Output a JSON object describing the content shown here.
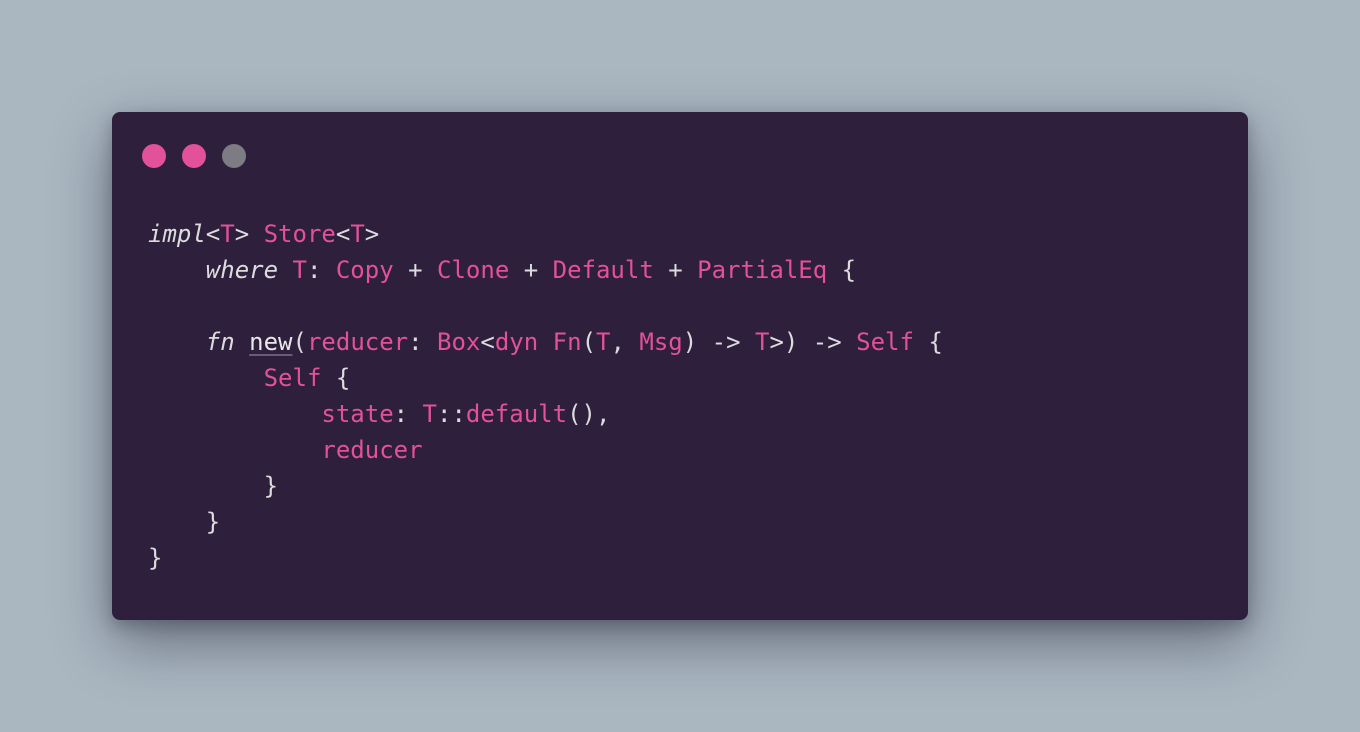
{
  "window": {
    "controls": [
      {
        "name": "close",
        "color": "#e2519a"
      },
      {
        "name": "minimize",
        "color": "#e2519a"
      },
      {
        "name": "zoom",
        "color": "#7c7c82"
      }
    ]
  },
  "code": {
    "lines": [
      [
        {
          "t": "impl",
          "c": "kw"
        },
        {
          "t": "<",
          "c": "pu"
        },
        {
          "t": "T",
          "c": "ty"
        },
        {
          "t": "> ",
          "c": "pu"
        },
        {
          "t": "Store",
          "c": "ty"
        },
        {
          "t": "<",
          "c": "pu"
        },
        {
          "t": "T",
          "c": "ty"
        },
        {
          "t": ">",
          "c": "pu"
        }
      ],
      [
        {
          "t": "    ",
          "c": "pl"
        },
        {
          "t": "where",
          "c": "kw"
        },
        {
          "t": " ",
          "c": "pl"
        },
        {
          "t": "T",
          "c": "ty"
        },
        {
          "t": ": ",
          "c": "pu"
        },
        {
          "t": "Copy",
          "c": "ty"
        },
        {
          "t": " + ",
          "c": "pu"
        },
        {
          "t": "Clone",
          "c": "ty"
        },
        {
          "t": " + ",
          "c": "pu"
        },
        {
          "t": "Default",
          "c": "ty"
        },
        {
          "t": " + ",
          "c": "pu"
        },
        {
          "t": "PartialEq",
          "c": "ty"
        },
        {
          "t": " {",
          "c": "pu"
        }
      ],
      [],
      [
        {
          "t": "    ",
          "c": "pl"
        },
        {
          "t": "fn",
          "c": "kw"
        },
        {
          "t": " ",
          "c": "pl"
        },
        {
          "t": "new",
          "c": "fnn"
        },
        {
          "t": "(",
          "c": "pu"
        },
        {
          "t": "reducer",
          "c": "id"
        },
        {
          "t": ": ",
          "c": "pu"
        },
        {
          "t": "Box",
          "c": "ty"
        },
        {
          "t": "<",
          "c": "pu"
        },
        {
          "t": "dyn",
          "c": "ty"
        },
        {
          "t": " ",
          "c": "pl"
        },
        {
          "t": "Fn",
          "c": "ty"
        },
        {
          "t": "(",
          "c": "pu"
        },
        {
          "t": "T",
          "c": "ty"
        },
        {
          "t": ", ",
          "c": "pu"
        },
        {
          "t": "Msg",
          "c": "ty"
        },
        {
          "t": ") -> ",
          "c": "pu"
        },
        {
          "t": "T",
          "c": "ty"
        },
        {
          "t": ">) -> ",
          "c": "pu"
        },
        {
          "t": "Self",
          "c": "ty"
        },
        {
          "t": " {",
          "c": "pu"
        }
      ],
      [
        {
          "t": "        ",
          "c": "pl"
        },
        {
          "t": "Self",
          "c": "ty"
        },
        {
          "t": " {",
          "c": "pu"
        }
      ],
      [
        {
          "t": "            ",
          "c": "pl"
        },
        {
          "t": "state",
          "c": "id"
        },
        {
          "t": ": ",
          "c": "pu"
        },
        {
          "t": "T",
          "c": "ty"
        },
        {
          "t": "::",
          "c": "pu"
        },
        {
          "t": "default",
          "c": "id"
        },
        {
          "t": "(),",
          "c": "pu"
        }
      ],
      [
        {
          "t": "            ",
          "c": "pl"
        },
        {
          "t": "reducer",
          "c": "id"
        }
      ],
      [
        {
          "t": "        ",
          "c": "pl"
        },
        {
          "t": "}",
          "c": "pu"
        }
      ],
      [
        {
          "t": "    ",
          "c": "pl"
        },
        {
          "t": "}",
          "c": "pu"
        }
      ],
      [
        {
          "t": "}",
          "c": "pu"
        }
      ]
    ]
  }
}
